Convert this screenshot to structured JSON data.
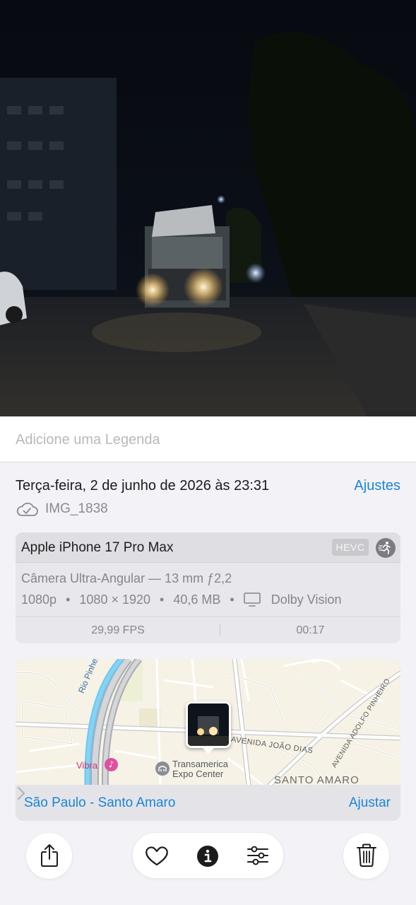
{
  "caption": {
    "placeholder": "Adicione uma Legenda"
  },
  "info": {
    "date_time": "Terça-feira, 2 de junho de 2026 às 23:31",
    "adjust_label": "Ajustes",
    "file_name": "IMG_1838",
    "cloud_icon": "icloud-icon"
  },
  "device": {
    "name": "Apple iPhone 17 Pro Max",
    "codec_badge": "HEVC",
    "lens": "Câmera Ultra-Angular — 13 mm ƒ2,2",
    "resolution": "1080p",
    "dimensions": "1080 × 1920",
    "file_size": "40,6 MB",
    "separator": "•",
    "hdr": "Dolby Vision",
    "fps": "29,99 FPS",
    "duration": "00:17"
  },
  "map": {
    "labels": {
      "rio_pinheiros": "Rio Pinheiros",
      "av_joao_dias": "AVENIDA JOÃO DIAS",
      "av_adolfo_pinheiro": "AVENIDA ADOLFO PINHEIRO",
      "vibra": "Vibra",
      "transamerica_line1": "Transamerica",
      "transamerica_line2": "Expo Center",
      "santo_amaro": "SANTO AMARO"
    },
    "location": "São Paulo - Santo Amaro",
    "adjust_label": "Ajustar"
  },
  "toolbar": {
    "share": "share-icon",
    "favorite": "heart-icon",
    "info": "info-icon",
    "adjust": "sliders-icon",
    "delete": "trash-icon"
  },
  "colors": {
    "accent": "#1a84d8",
    "background": "#f2f2f7"
  }
}
